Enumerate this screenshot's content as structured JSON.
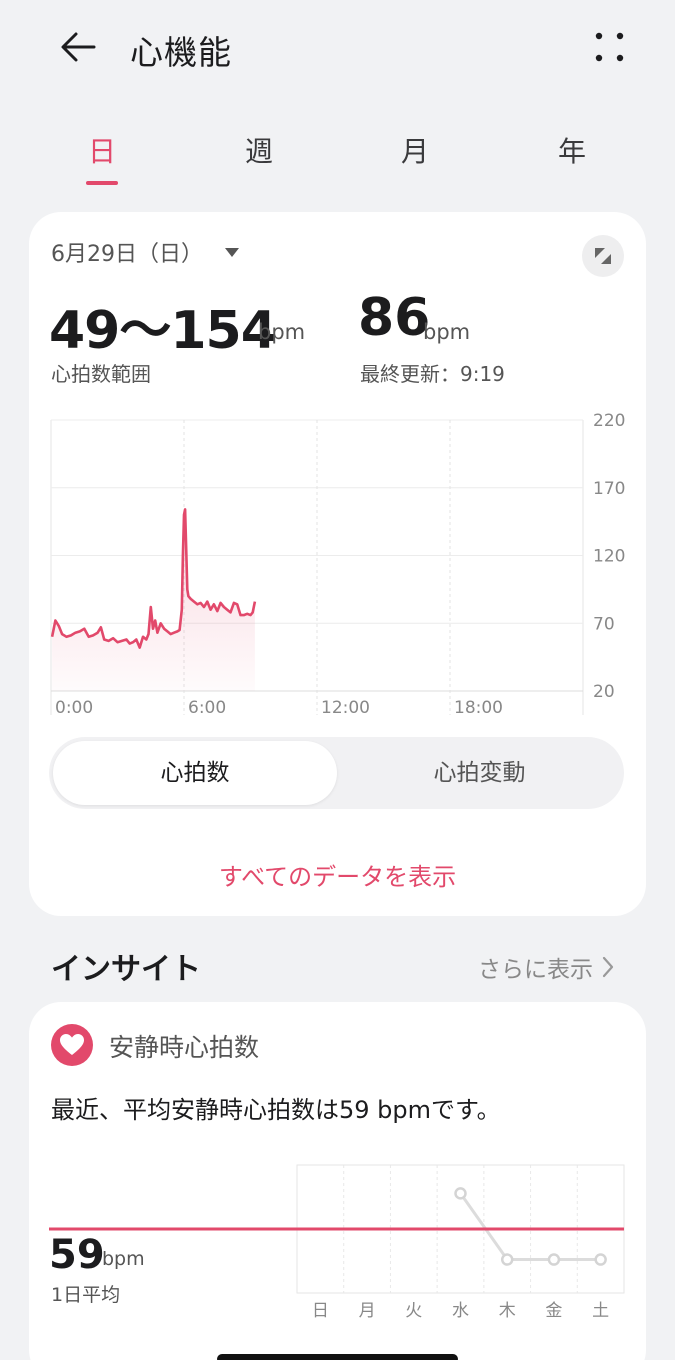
{
  "header": {
    "title": "心機能",
    "back_icon": "arrow-left-icon",
    "menu_icon": "more-dots-icon"
  },
  "tabs": [
    {
      "label": "日",
      "active": true
    },
    {
      "label": "週",
      "active": false
    },
    {
      "label": "月",
      "active": false
    },
    {
      "label": "年",
      "active": false
    }
  ],
  "summary": {
    "date": "6月29日（日）",
    "range_value": "49〜154",
    "range_unit": "bpm",
    "range_label": "心拍数範囲",
    "latest_value": "86",
    "latest_unit": "bpm",
    "latest_label": "最終更新：9:19"
  },
  "chart_data": {
    "type": "area",
    "y_ticks": [
      "220",
      "170",
      "120",
      "70",
      "20"
    ],
    "x_ticks": [
      "0:00",
      "6:00",
      "12:00",
      "18:00"
    ],
    "ylim": [
      20,
      220
    ],
    "xlim": [
      0,
      24
    ],
    "color": "#e2496b",
    "x": [
      0.05,
      0.2,
      0.35,
      0.5,
      0.7,
      0.9,
      1.1,
      1.3,
      1.5,
      1.7,
      1.9,
      2.1,
      2.25,
      2.4,
      2.6,
      2.8,
      3.0,
      3.2,
      3.4,
      3.55,
      3.7,
      3.85,
      4.0,
      4.15,
      4.3,
      4.4,
      4.5,
      4.6,
      4.7,
      4.8,
      4.95,
      5.1,
      5.25,
      5.4,
      5.55,
      5.7,
      5.8,
      5.9,
      5.95,
      6.0,
      6.05,
      6.1,
      6.15,
      6.2,
      6.3,
      6.45,
      6.6,
      6.75,
      6.9,
      7.05,
      7.2,
      7.35,
      7.5,
      7.65,
      7.8,
      7.95,
      8.1,
      8.25,
      8.4,
      8.55,
      8.7,
      8.85,
      9.0,
      9.1,
      9.2
    ],
    "y": [
      60,
      72,
      68,
      62,
      60,
      61,
      63,
      64,
      66,
      60,
      61,
      63,
      67,
      58,
      57,
      59,
      56,
      57,
      58,
      55,
      56,
      58,
      52,
      60,
      58,
      62,
      82,
      66,
      72,
      63,
      70,
      66,
      64,
      62,
      63,
      64,
      65,
      80,
      120,
      150,
      154,
      125,
      95,
      90,
      88,
      86,
      84,
      85,
      82,
      86,
      80,
      84,
      79,
      85,
      82,
      80,
      78,
      85,
      84,
      76,
      76,
      77,
      76,
      78,
      86
    ]
  },
  "segmented": {
    "options": [
      "心拍数",
      "心拍変動"
    ],
    "active_index": 0
  },
  "view_all_label": "すべてのデータを表示",
  "insights": {
    "title": "インサイト",
    "see_more": "さらに表示",
    "card": {
      "icon": "heart-icon",
      "title": "安静時心拍数",
      "text": "最近、平均安静時心拍数は59 bpmです。",
      "value": "59",
      "unit": "bpm",
      "value_label": "1日平均",
      "days": [
        "日",
        "月",
        "火",
        "水",
        "木",
        "金",
        "土"
      ],
      "daily_values": [
        null,
        null,
        null,
        68,
        55,
        55,
        55
      ],
      "average_line": 59
    }
  }
}
